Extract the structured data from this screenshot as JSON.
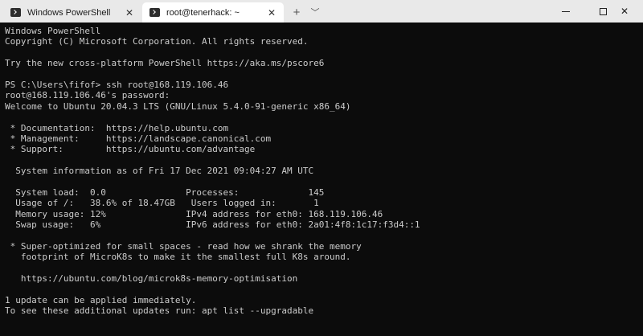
{
  "tabs": [
    {
      "label": "Windows PowerShell",
      "close": "✕",
      "icon": "powershell-icon"
    },
    {
      "label": "root@tenerhack: ~",
      "close": "✕",
      "icon": "terminal-icon"
    }
  ],
  "new_tab": "+",
  "dropdown": "﹀",
  "window_controls": {
    "close": "✕"
  },
  "colors": {
    "terminal_bg": "#0c0c0c",
    "terminal_fg": "#cccccc",
    "titlebar": "#e9e9e9",
    "active_tab": "#ffffff"
  },
  "terminal_lines": [
    "Windows PowerShell",
    "Copyright (C) Microsoft Corporation. All rights reserved.",
    "",
    "Try the new cross-platform PowerShell https://aka.ms/pscore6",
    "",
    "PS C:\\Users\\fifof> ssh root@168.119.106.46",
    "root@168.119.106.46's password:",
    "Welcome to Ubuntu 20.04.3 LTS (GNU/Linux 5.4.0-91-generic x86_64)",
    "",
    " * Documentation:  https://help.ubuntu.com",
    " * Management:     https://landscape.canonical.com",
    " * Support:        https://ubuntu.com/advantage",
    "",
    "  System information as of Fri 17 Dec 2021 09:04:27 AM UTC",
    "",
    "  System load:  0.0               Processes:             145",
    "  Usage of /:   38.6% of 18.47GB   Users logged in:       1",
    "  Memory usage: 12%               IPv4 address for eth0: 168.119.106.46",
    "  Swap usage:   6%                IPv6 address for eth0: 2a01:4f8:1c17:f3d4::1",
    "",
    " * Super-optimized for small spaces - read how we shrank the memory",
    "   footprint of MicroK8s to make it the smallest full K8s around.",
    "",
    "   https://ubuntu.com/blog/microk8s-memory-optimisation",
    "",
    "1 update can be applied immediately.",
    "To see these additional updates run: apt list --upgradable"
  ]
}
